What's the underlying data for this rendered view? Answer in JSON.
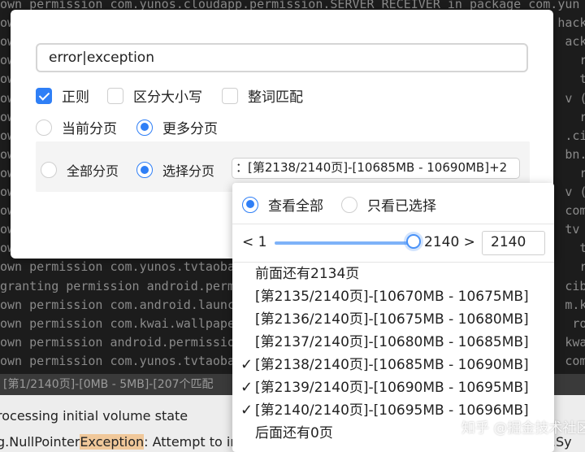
{
  "terminal": {
    "lines": [
      {
        "text": "own permission com.yunos.cloudapp.permission.SERVER_RECEIVER in package com.yun",
        "hl": false
      },
      {
        "text": "own                                                                         hacka",
        "hl": false
      },
      {
        "text": "own                                                                          ackag",
        "hl": false
      },
      {
        "text": "own                                                                            ro",
        "hl": false
      },
      {
        "text": "own                                                                            tv",
        "hl": false
      },
      {
        "text": "own                                                                          v (p",
        "hl": false
      },
      {
        "text": "own                                                                            ro",
        "hl": false
      },
      {
        "text": "own                                                                          .cibn",
        "hl": false
      },
      {
        "text": "own                                                                          bn.tv",
        "hl": false
      },
      {
        "text": "own                                                                            ro",
        "hl": false
      },
      {
        "text": "own                                                                          v (p",
        "hl": false
      },
      {
        "text": "own                                                                          com.",
        "hl": false
      },
      {
        "text": "own                                                                          tv",
        "hl": false
      },
      {
        "text": "own permission com.yunos.datacen                                               tv",
        "hl": false
      },
      {
        "text": "own permission com.yunos.tvtaoba                                               ro",
        "hl": false
      },
      {
        "text": "granting permission android.perm                                             cibn",
        "hl": false
      },
      {
        "text": "own permission com.android.launc                                             m.kw",
        "hl": false
      },
      {
        "text": "own permission com.kwai.wallpape                                              ro",
        "hl": false
      },
      {
        "text": "own permission android.permissio                                             kwai",
        "hl": false
      },
      {
        "text": "own permission com.yunos.tvtaoba                                             com.",
        "hl": false
      }
    ],
    "status": "[第1/2140页]-[0MB - 5MB]-[207个匹配",
    "bottom_line1": "rocessing initial volume state",
    "bottom_line2_pre": "g.NullPointer",
    "bottom_line2_hl": "Exception",
    "bottom_line2_post": ": Attempt to invoke virtual method 'java.lang.String android.os.Sy"
  },
  "search": {
    "value": "error|exception"
  },
  "options": {
    "regex": "正则",
    "case": "区分大小写",
    "whole_word": "整词匹配",
    "current_page": "当前分页",
    "more_pages": "更多分页",
    "all_pages": "全部分页",
    "select_pages": "选择分页",
    "page_select_value": "：[第2138/2140页]-[10685MB - 10690MB]+2"
  },
  "dropdown": {
    "view_all": "查看全部",
    "view_selected": "只看已选择",
    "slider": {
      "prev": "< 1",
      "next": "2140 >",
      "input": "2140",
      "value_fraction": 1.0
    },
    "items": [
      {
        "label": "前面还有2134页",
        "checked": false
      },
      {
        "label": "[第2135/2140页]-[10670MB - 10675MB]",
        "checked": false
      },
      {
        "label": "[第2136/2140页]-[10675MB - 10680MB]",
        "checked": false
      },
      {
        "label": "[第2137/2140页]-[10680MB - 10685MB]",
        "checked": false
      },
      {
        "label": "[第2138/2140页]-[10685MB - 10690MB]",
        "checked": true
      },
      {
        "label": "[第2139/2140页]-[10690MB - 10695MB]",
        "checked": true
      },
      {
        "label": "[第2140/2140页]-[10695MB - 10696MB]",
        "checked": true
      },
      {
        "label": "后面还有0页",
        "checked": false
      }
    ]
  },
  "watermark": "知乎 @掘金技术社区",
  "colors": {
    "accent": "#2f7ff6",
    "terminal_bg": "#1c1c1c"
  }
}
